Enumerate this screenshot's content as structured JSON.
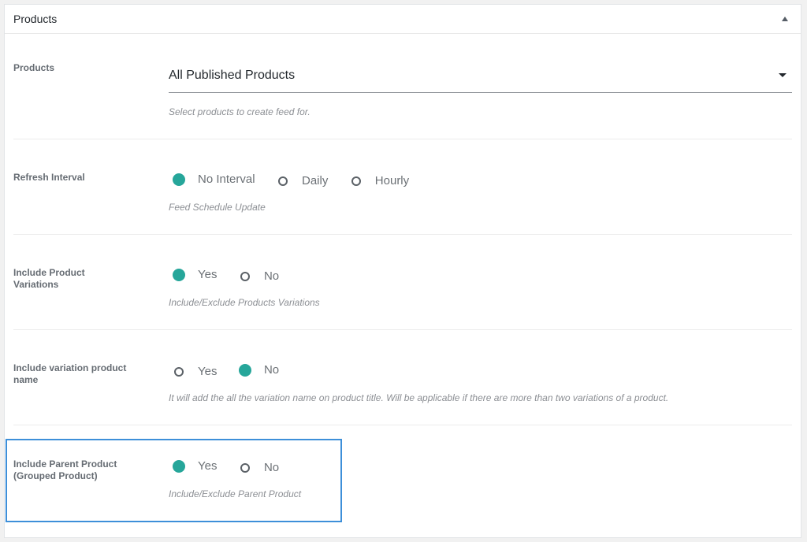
{
  "panel": {
    "title": "Products"
  },
  "fields": {
    "products": {
      "label": "Products",
      "selected": "All Published Products",
      "help": "Select products to create feed for."
    },
    "refresh_interval": {
      "label": "Refresh Interval",
      "options": [
        "No Interval",
        "Daily",
        "Hourly"
      ],
      "selected": "No Interval",
      "help": "Feed Schedule Update"
    },
    "include_variations": {
      "label": "Include Product Variations",
      "options": [
        "Yes",
        "No"
      ],
      "selected": "Yes",
      "help": "Include/Exclude Products Variations"
    },
    "variation_name": {
      "label": "Include variation product name",
      "options": [
        "Yes",
        "No"
      ],
      "selected": "No",
      "help": "It will add the all the variation name on product title. Will be applicable if there are more than two variations of a product."
    },
    "parent_product": {
      "label": "Include Parent Product (Grouped Product)",
      "options": [
        "Yes",
        "No"
      ],
      "selected": "Yes",
      "help": "Include/Exclude Parent Product"
    }
  },
  "colors": {
    "accent": "#26a69a",
    "highlight": "#3d8fd9"
  }
}
